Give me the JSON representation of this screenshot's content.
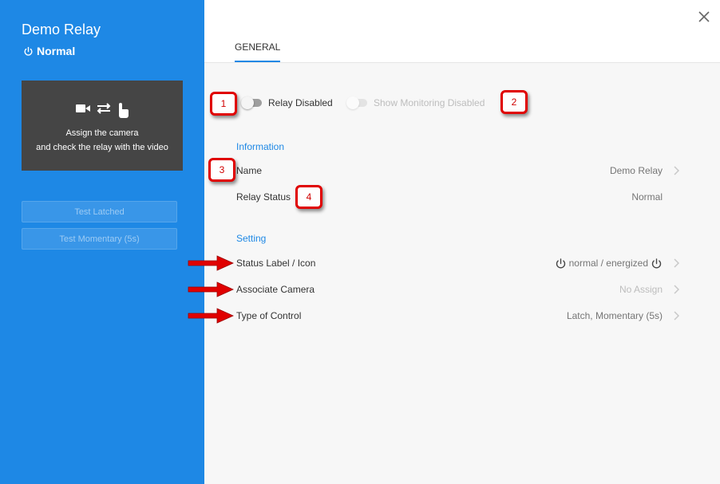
{
  "sidebar": {
    "device_title": "Demo Relay",
    "device_status": "Normal",
    "camera_box": {
      "icons": [
        "video-camera-icon",
        "swap-arrows-icon",
        "touch-hand-icon"
      ],
      "line1": "Assign the camera",
      "line2": "and check the relay with the video"
    },
    "test_latched_label": "Test Latched",
    "test_momentary_label": "Test Momentary (5s)"
  },
  "header": {
    "tab_general": "GENERAL",
    "close_icon": "close-icon"
  },
  "toggles": {
    "relay_label": "Relay Disabled",
    "monitoring_label": "Show Monitoring Disabled"
  },
  "information": {
    "title": "Information",
    "name_label": "Name",
    "name_value": "Demo Relay",
    "relay_status_label": "Relay Status",
    "relay_status_value": "Normal"
  },
  "setting": {
    "title": "Setting",
    "status_label_label": "Status Label / Icon",
    "status_label_value": "normal / energized",
    "associate_camera_label": "Associate Camera",
    "associate_camera_value": "No Assign",
    "type_of_control_label": "Type of Control",
    "type_of_control_value": "Latch, Momentary (5s)"
  },
  "annotations": {
    "marker1": "1",
    "marker2": "2",
    "marker3": "3",
    "marker4": "4",
    "arrow_color": "#e00000"
  },
  "colors": {
    "accent": "#1e88e5",
    "camera_box": "#454545"
  }
}
